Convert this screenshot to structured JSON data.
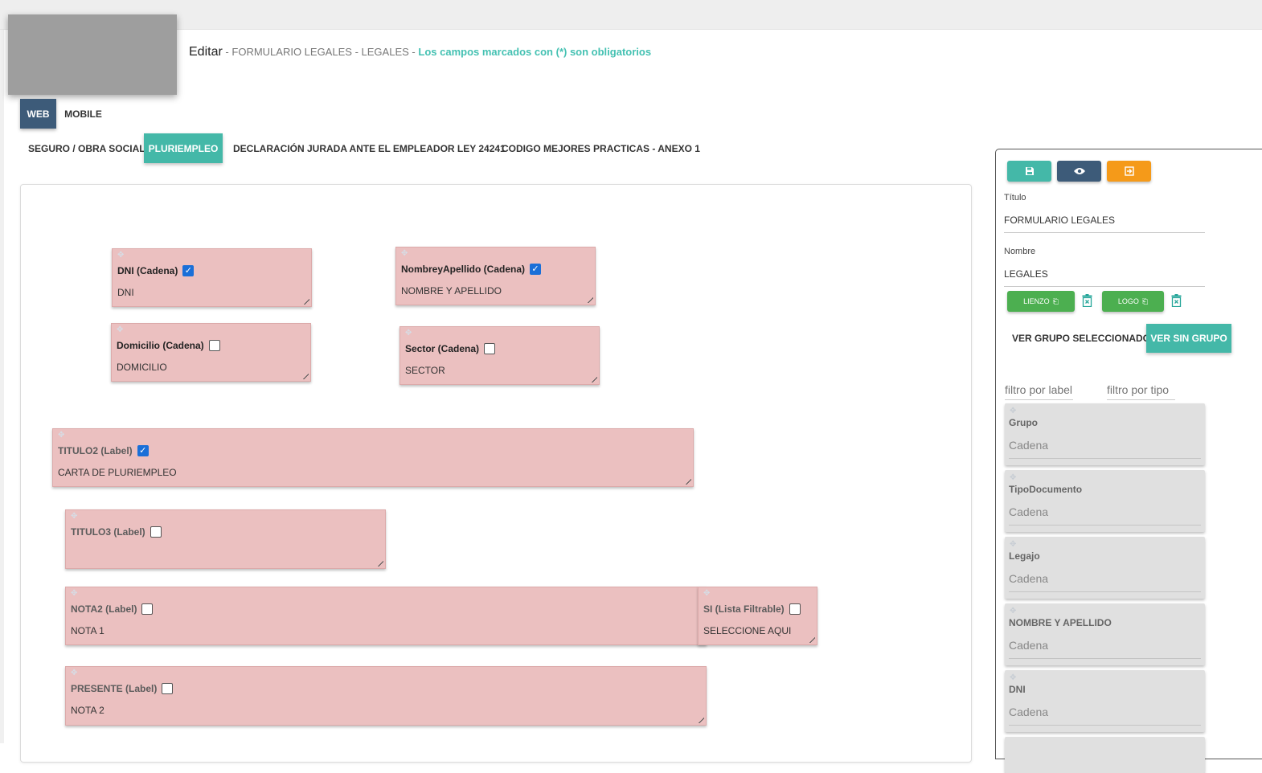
{
  "header": {
    "edit": "Editar",
    "separator": "-",
    "form_title": "FORMULARIO LEGALES",
    "form_name": "LEGALES",
    "required_note": "Los campos marcados con (*) son obligatorios"
  },
  "mode_tabs": [
    {
      "label": "WEB",
      "active": true
    },
    {
      "label": "MOBILE",
      "active": false
    }
  ],
  "section_tabs": [
    {
      "label": "SEGURO / OBRA SOCIAL",
      "active": false
    },
    {
      "label": "PLURIEMPLEO",
      "active": true
    },
    {
      "label": "DECLARACIÓN JURADA ANTE EL EMPLEADOR LEY 24241",
      "active": false
    },
    {
      "label": "CODIGO MEJORES PRACTICAS - ANEXO 1",
      "active": false
    }
  ],
  "fields": [
    {
      "label": "DNI (Cadena)",
      "checked": true,
      "value": "DNI"
    },
    {
      "label": "NombreyApellido (Cadena)",
      "checked": true,
      "value": "NOMBRE Y APELLIDO"
    },
    {
      "label": "Domicilio (Cadena)",
      "checked": false,
      "value": "DOMICILIO"
    },
    {
      "label": "Sector (Cadena)",
      "checked": false,
      "value": "SECTOR"
    },
    {
      "label": "TITULO2 (Label)",
      "checked": true,
      "value": "CARTA DE PLURIEMPLEO"
    },
    {
      "label": "TITULO3 (Label)",
      "checked": false,
      "value": ""
    },
    {
      "label": "NOTA2 (Label)",
      "checked": false,
      "value": "NOTA 1"
    },
    {
      "label": "SI (Lista Filtrable)",
      "checked": false,
      "value": "SELECCIONE AQUI"
    },
    {
      "label": "PRESENTE (Label)",
      "checked": false,
      "value": "NOTA 2"
    }
  ],
  "panel": {
    "buttons": [
      {
        "icon": "save-icon",
        "color": "#44b8a8"
      },
      {
        "icon": "eye-icon",
        "color": "#3d5b79"
      },
      {
        "icon": "exit-icon",
        "color": "#f59a19"
      }
    ],
    "titulo_label": "Título",
    "titulo_value": "FORMULARIO LEGALES",
    "nombre_label": "Nombre",
    "nombre_value": "LEGALES",
    "lienzo_label": "LIENZO",
    "logo_label": "LOGO",
    "group_selected": "VER GRUPO SELECCIONADO",
    "group_none": "VER SIN GRUPO",
    "filter_label_placeholder": "filtro por label",
    "filter_type_placeholder": "filtro por tipo",
    "templates": [
      {
        "name": "Grupo",
        "type": "Cadena"
      },
      {
        "name": "TipoDocumento",
        "type": "Cadena"
      },
      {
        "name": "Legajo",
        "type": "Cadena"
      },
      {
        "name": "NOMBRE Y APELLIDO",
        "type": "Cadena"
      },
      {
        "name": "DNI",
        "type": "Cadena"
      }
    ]
  },
  "colors": {
    "accent_teal": "#44b8a8",
    "navy": "#3d5b79",
    "orange": "#f59a19",
    "green": "#4caf50",
    "field_bg": "#ebc0c0",
    "checkbox_checked": "#1a6fd8"
  }
}
